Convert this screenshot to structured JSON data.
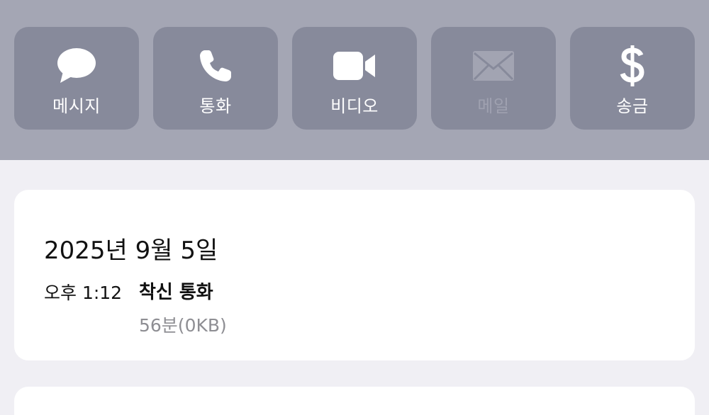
{
  "actions": [
    {
      "label": "메시지",
      "icon": "message-bubble-icon",
      "enabled": true
    },
    {
      "label": "통화",
      "icon": "phone-icon",
      "enabled": true
    },
    {
      "label": "비디오",
      "icon": "video-camera-icon",
      "enabled": true
    },
    {
      "label": "메일",
      "icon": "mail-envelope-icon",
      "enabled": false
    },
    {
      "label": "송금",
      "icon": "dollar-icon",
      "enabled": true
    }
  ],
  "call_log": {
    "date": "2025년 9월 5일",
    "entries": [
      {
        "time": "오후 1:12",
        "type": "착신 통화",
        "detail": "56분(0KB)"
      }
    ]
  },
  "colors": {
    "header_bg": "#a4a6b4",
    "button_bg": "#878a9b",
    "page_bg": "#f0eff4",
    "secondary_text": "#8e8e93"
  }
}
